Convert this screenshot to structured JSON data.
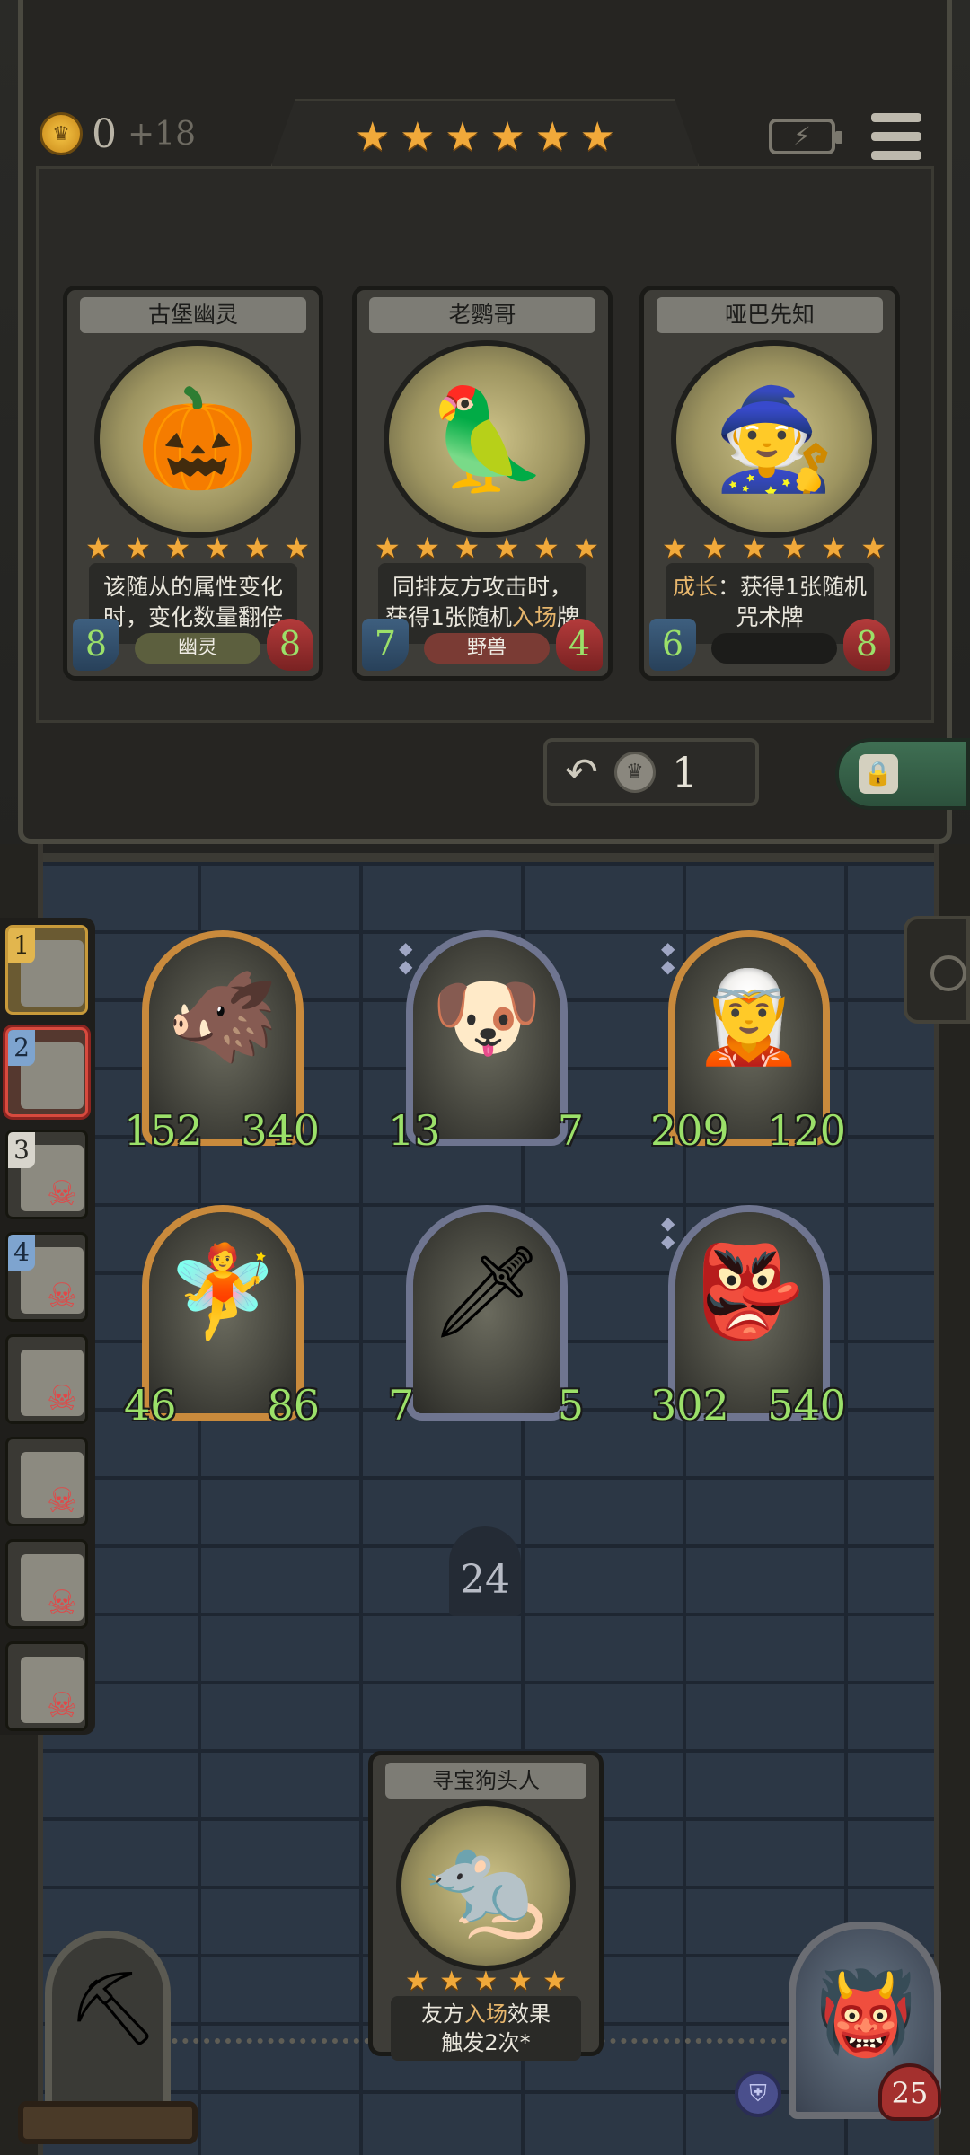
{
  "header": {
    "gold": "0",
    "gold_income": "+18",
    "tier_stars": "★★★★★★"
  },
  "shop": {
    "cards": [
      {
        "name": "古堡幽灵",
        "stars": "★★★★★★",
        "text_line1": "该随从的属性变化",
        "text_line2": "时，变化数量翻倍",
        "attack": "8",
        "health": "8",
        "tribe": "幽灵",
        "tribe_color": "#5c5f3e",
        "art_icon": "pumpkin-ghosts-art"
      },
      {
        "name": "老鹦哥",
        "stars": "★★★★★★",
        "text_line1": "同排友方攻击时，",
        "text_line2_pre": "获得1张随机",
        "text_line2_hl": "入场",
        "text_line2_post": "牌",
        "attack": "7",
        "health": "4",
        "tribe": "野兽",
        "tribe_color": "#7a3b34",
        "art_icon": "parrot-art"
      },
      {
        "name": "哑巴先知",
        "stars": "★★★★★★",
        "text_line1_hl": "成长",
        "text_line1_post": "：获得1张随机",
        "text_line2": "咒术牌",
        "attack": "6",
        "health": "8",
        "tribe": "",
        "tribe_color": "#1c1c1a",
        "art_icon": "witch-prophet-art"
      }
    ],
    "refresh_cost": "1"
  },
  "players": [
    {
      "rank": "1",
      "status": "current"
    },
    {
      "rank": "2",
      "status": "active"
    },
    {
      "rank": "3",
      "status": "dead"
    },
    {
      "rank": "4",
      "status": "dead"
    },
    {
      "rank": "",
      "status": "dead"
    },
    {
      "rank": "",
      "status": "dead"
    },
    {
      "rank": "",
      "status": "dead"
    },
    {
      "rank": "",
      "status": "dead"
    }
  ],
  "board": {
    "minions": [
      {
        "attack": "152",
        "health": "340",
        "frame": "gold",
        "art_icon": "boar-art"
      },
      {
        "attack": "13",
        "health": "7",
        "frame": "silver",
        "art_icon": "dog-mask-art"
      },
      {
        "attack": "209",
        "health": "120",
        "frame": "gold",
        "art_icon": "elf-queen-art"
      },
      {
        "attack": "46",
        "health": "86",
        "frame": "gold",
        "art_icon": "fairy-art"
      },
      {
        "attack": "7",
        "health": "5",
        "frame": "silver",
        "art_icon": "green-flame-totem-art"
      },
      {
        "attack": "302",
        "health": "540",
        "frame": "silver",
        "art_icon": "goblin-witch-art"
      }
    ],
    "turn": "24"
  },
  "hand": {
    "name": "寻宝狗头人",
    "stars": "★★★★★",
    "text_line1_pre": "友方",
    "text_line1_hl": "入场",
    "text_line1_post": "效果",
    "text_line2": "触发2次*",
    "art_icon": "kobold-art"
  },
  "hero": {
    "health": "25"
  },
  "colors": {
    "stat_green": "#9be069",
    "highlight": "#e7b66c",
    "star": "#f1a93a"
  }
}
